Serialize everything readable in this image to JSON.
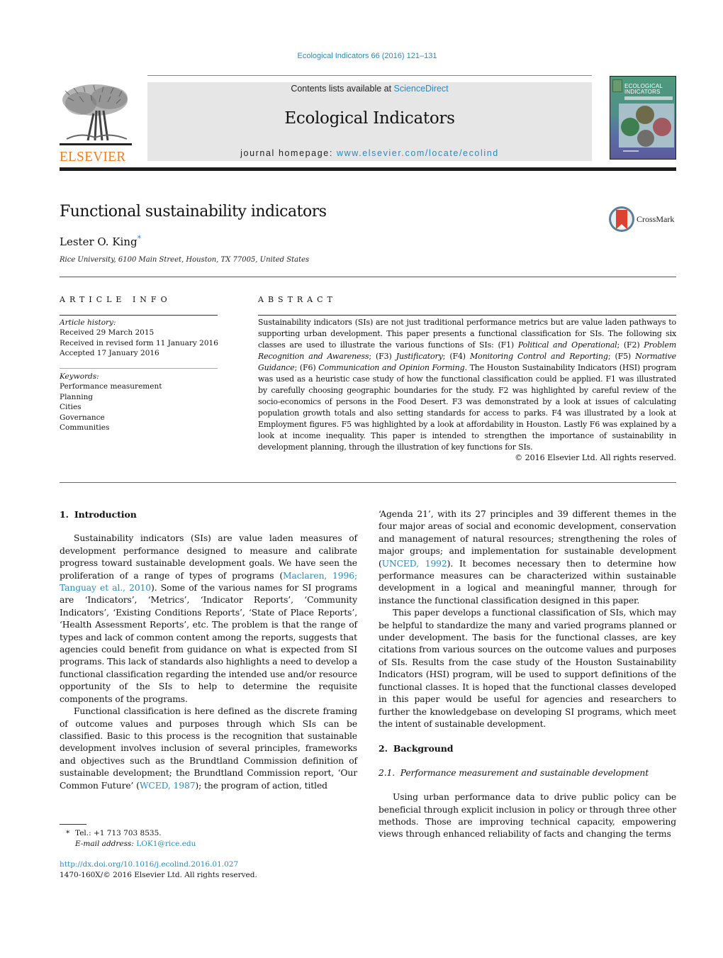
{
  "header": {
    "journal_reference": "Ecological Indicators 66 (2016) 121–131",
    "publisher": "ELSEVIER",
    "contents_prefix": "Contents lists available at ",
    "contents_link": "ScienceDirect",
    "journal_title": "Ecological Indicators",
    "homepage_prefix": "journal homepage: ",
    "homepage_link": "www.elsevier.com/locate/ecolind",
    "cover_title_line1": "ECOLOGICAL",
    "cover_title_line2": "INDICATORS",
    "crossmark_label": "CrossMark"
  },
  "article": {
    "title": "Functional sustainability indicators",
    "author": "Lester O. King",
    "author_mark": "*",
    "affiliation": "Rice University, 6100 Main Street, Houston, TX 77005, United States"
  },
  "article_info": {
    "label": "ARTICLE INFO",
    "history_heading": "Article history:",
    "history": [
      "Received 29 March 2015",
      "Received in revised form 11 January 2016",
      "Accepted 17 January 2016"
    ],
    "keywords_heading": "Keywords:",
    "keywords": [
      "Performance measurement",
      "Planning",
      "Cities",
      "Governance",
      "Communities"
    ]
  },
  "abstract": {
    "label": "ABSTRACT",
    "segments": [
      "Sustainability indicators (SIs) are not just traditional performance metrics but are value laden pathways to supporting urban development. This paper presents a functional classification for SIs. The following six classes are used to illustrate the various functions of SIs: (F1) ",
      "Political and Operational",
      "; (F2) ",
      "Problem Recognition and Awareness",
      "; (F3) ",
      "Justificatory",
      "; (F4) ",
      "Monitoring Control and Reporting",
      "; (F5) ",
      "Normative Guidance",
      "; (F6) ",
      "Communication and Opinion Forming",
      ". The Houston Sustainability Indicators (HSI) program was used as a heuristic case study of how the functional classification could be applied. F1 was illustrated by carefully choosing geographic boundaries for the study. F2 was highlighted by careful review of the socio-economics of persons in the Food Desert. F3 was demonstrated by a look at issues of calculating population growth totals and also setting standards for access to parks. F4 was illustrated by a look at Employment figures. F5 was highlighted by a look at affordability in Houston. Lastly F6 was explained by a look at income inequality. This paper is intended to strengthen the importance of sustainability in development planning, through the illustration of key functions for SIs."
    ],
    "copyright": "© 2016 Elsevier Ltd. All rights reserved."
  },
  "body": {
    "section1": {
      "number": "1.",
      "title": "Introduction",
      "p1_a": "Sustainability indicators (SIs) are value laden measures of development performance designed to measure and calibrate progress toward sustainable development goals. We have seen the proliferation of a range of types of programs (",
      "p1_cite": "Maclaren, 1996; Tanguay et al., 2010",
      "p1_b": "). Some of the various names for SI programs are ‘Indicators’, ‘Metrics’, ‘Indicator Reports’, ‘Community Indicators’, ‘Existing Conditions Reports’, ‘State of Place Reports’, ‘Health Assessment Reports’, etc. The problem is that the range of types and lack of common content among the reports, suggests that agencies could benefit from guidance on what is expected from SI programs. This lack of standards also highlights a need to develop a functional classification regarding the intended use and/or resource opportunity of the SIs to help to determine the requisite components of the programs.",
      "p2_a": "Functional classification is here defined as the discrete framing of outcome values and purposes through which SIs can be classified. Basic to this process is the recognition that sustainable development involves inclusion of several principles, frameworks and objectives such as the Brundtland Commission definition of sustainable development; the Brundtland Commission report, ‘Our Common Future’ (",
      "p2_cite1": "WCED, 1987",
      "p2_b": "); the program of action, titled ‘Agenda 21’, with its 27 principles and 39 different themes in the four major areas of social and economic development, conservation and management of natural resources; strengthening the roles of major groups; and implementation for sustainable development (",
      "p2_cite2": "UNCED, 1992",
      "p2_c": "). It becomes necessary then to determine how performance measures can be characterized within sustainable development in a logical and meaningful manner, through for instance the functional classification designed in this paper.",
      "p3": "This paper develops a functional classification of SIs, which may be helpful to standardize the many and varied programs planned or under development. The basis for the functional classes, are key citations from various sources on the outcome values and purposes of SIs. Results from the case study of the Houston Sustainability Indicators (HSI) program, will be used to support definitions of the functional classes. It is hoped that the functional classes developed in this paper would be useful for agencies and researchers to further the knowledgebase on developing SI programs, which meet the intent of sustainable development."
    },
    "section2": {
      "number": "2.",
      "title": "Background",
      "subsection_number": "2.1.",
      "subsection_title": "Performance measurement and sustainable development",
      "p1": "Using urban performance data to drive public policy can be beneficial through explicit inclusion in policy or through three other methods. Those are improving technical capacity, empowering views through enhanced reliability of facts and changing the terms"
    }
  },
  "footnotes": {
    "mark": "*",
    "tel": "Tel.: +1 713 703 8535.",
    "email_label": "E-mail address: ",
    "email": "LOK1@rice.edu",
    "doi": "http://dx.doi.org/10.1016/j.ecolind.2016.01.027",
    "issn_copyright": "1470-160X/© 2016 Elsevier Ltd. All rights reserved."
  },
  "colors": {
    "link": "#2a8ab8",
    "elsevier_orange": "#f07c1e",
    "banner_gray": "#e6e6e6"
  }
}
